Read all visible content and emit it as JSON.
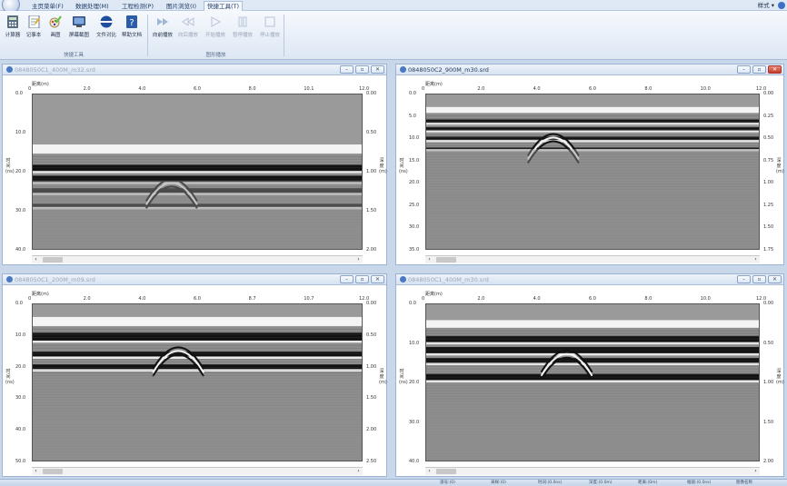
{
  "menu": {
    "tabs": [
      "主页菜单(F)",
      "数据处理(M)",
      "工程检测(P)",
      "图片浏览(I)",
      "快捷工具(T)"
    ],
    "active": 4,
    "style_label": "样式"
  },
  "ribbon": {
    "group1": {
      "label": "快捷工具",
      "buttons": [
        "计算器",
        "记事本",
        "画图",
        "屏幕截图",
        "文件对比",
        "帮助文档"
      ]
    },
    "group2": {
      "label": "图形播放",
      "buttons": [
        "向前播放",
        "向后播放",
        "开始播放",
        "暂停播放",
        "停止播放"
      ]
    }
  },
  "colors": {
    "accent": "#3d70c4",
    "close": "#c33b24"
  },
  "panels": [
    {
      "title": "0848050C1_400M_m32.srd",
      "active": false,
      "x_axis_label": "距离(m)",
      "x_ticks": [
        "0",
        "2.0",
        "4.0",
        "6.0",
        "8.0",
        "10.1",
        "12.0"
      ],
      "y_left_ticks": [
        "0.0",
        "10.0",
        "20.0",
        "30.0",
        "40.0"
      ],
      "y_left_label": "时间(ns)",
      "y_right_ticks": [
        "0.00",
        "0.50",
        "1.00",
        "1.50",
        "2.00"
      ],
      "y_right_label": "深度(m)"
    },
    {
      "title": "0848050C2_900M_m30.srd",
      "active": true,
      "x_axis_label": "距离(m)",
      "x_ticks": [
        "0",
        "2.0",
        "4.0",
        "6.0",
        "8.0",
        "10.0",
        "12.0"
      ],
      "y_left_ticks": [
        "0.0",
        "5.0",
        "10.0",
        "15.0",
        "20.0",
        "25.0",
        "30.0",
        "35.0"
      ],
      "y_left_label": "时间(ns)",
      "y_right_ticks": [
        "0.00",
        "0.25",
        "0.50",
        "0.75",
        "1.00",
        "1.25",
        "1.50",
        "1.75"
      ],
      "y_right_label": "深度(m)"
    },
    {
      "title": "0848050C1_200M_m09.srd",
      "active": false,
      "x_axis_label": "距离(m)",
      "x_ticks": [
        "0",
        "2.0",
        "4.0",
        "6.0",
        "8.7",
        "10.7",
        "12.0"
      ],
      "y_left_ticks": [
        "0.0",
        "10.0",
        "20.0",
        "30.0",
        "40.0",
        "50.0"
      ],
      "y_left_label": "时间(ns)",
      "y_right_ticks": [
        "0.00",
        "0.50",
        "1.00",
        "1.50",
        "2.00",
        "2.50"
      ],
      "y_right_label": "深度(m)"
    },
    {
      "title": "0848050C1_400M_m30.srd",
      "active": false,
      "x_axis_label": "距离(m)",
      "x_ticks": [
        "0",
        "2.0",
        "4.0",
        "6.0",
        "8.0",
        "10.0",
        "12.0"
      ],
      "y_left_ticks": [
        "0.0",
        "10.0",
        "20.0",
        "30.0",
        "40.0"
      ],
      "y_left_label": "时间(ns)",
      "y_right_ticks": [
        "0.00",
        "0.50",
        "1.00",
        "1.50",
        "2.00"
      ],
      "y_right_label": "深度(m)"
    }
  ],
  "status": [
    "道号:(0)",
    "采样:(0)",
    "时间:(0.0ns)",
    "深度:(0.0m)",
    "距离:(0m)",
    "幅值:(0.0ns)",
    "图像名称"
  ]
}
